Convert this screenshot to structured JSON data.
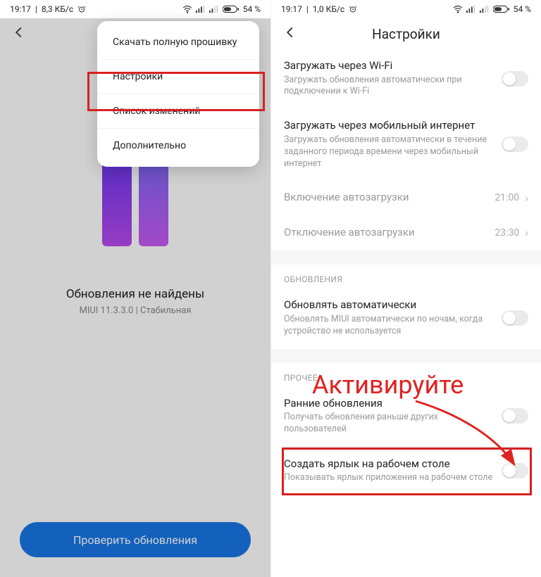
{
  "left": {
    "statusbar": {
      "time": "19:17",
      "net": "8,3 КБ/с",
      "battery": "54"
    },
    "status_title": "Обновления не найдены",
    "status_sub": "MIUI 11.3.3.0 | Стабильная",
    "check_button": "Проверить обновления",
    "popup": {
      "download": "Скачать полную прошивку",
      "settings": "Настройки",
      "changelog": "Список изменений",
      "more": "Дополнительно"
    }
  },
  "right": {
    "statusbar": {
      "time": "19:17",
      "net": "1,0 КБ/с",
      "battery": "54"
    },
    "title": "Настройки",
    "wifi": {
      "title": "Загружать через Wi-Fi",
      "sub": "Загружать обновления автоматически при подключении к Wi-Fi"
    },
    "mobile": {
      "title": "Загружать через мобильный интернет",
      "sub": "Загружать обновления автоматически в течение заданного периода времени через мобильный интернет"
    },
    "auto_on": {
      "title": "Включение автозагрузки",
      "value": "21:00"
    },
    "auto_off": {
      "title": "Отключение автозагрузки",
      "value": "23:30"
    },
    "section_updates": "ОБНОВЛЕНИЯ",
    "auto_update": {
      "title": "Обновлять автоматически",
      "sub": "Обновлять MIUI автоматически по ночам, когда устройство не используется"
    },
    "section_other": "ПРОЧЕЕ",
    "early": {
      "title": "Ранние обновления",
      "sub": "Получать обновления раньше других пользователей"
    },
    "shortcut": {
      "title": "Создать ярлык на рабочем столе",
      "sub": "Показывать ярлык приложения на рабочем столе"
    }
  },
  "annotation": {
    "label": "Активируйте"
  },
  "icons": {
    "alarm": "⏰",
    "pct": "%"
  }
}
